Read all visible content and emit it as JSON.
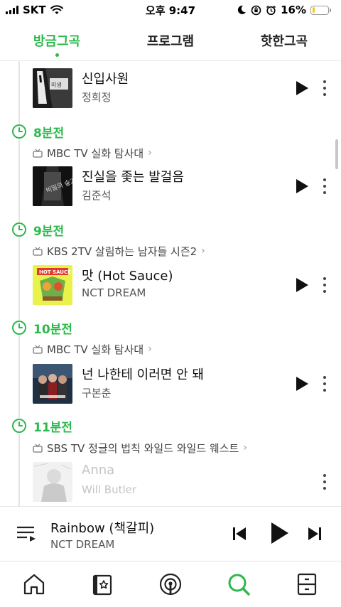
{
  "status_bar": {
    "carrier": "SKT",
    "time": "오후 9:47",
    "battery_percent": "16%",
    "battery_level": 0.16
  },
  "tabs": [
    {
      "label": "방금그곡",
      "active": true
    },
    {
      "label": "프로그램",
      "active": false
    },
    {
      "label": "핫한그곡",
      "active": false
    }
  ],
  "list": {
    "first_song": {
      "title": "신입사원",
      "artist": "정희정"
    },
    "sections": [
      {
        "time": "8분전",
        "program": "MBC TV 실화 탐사대",
        "song": {
          "title": "진실을 좇는 발걸음",
          "artist": "김준석"
        }
      },
      {
        "time": "9분전",
        "program": "KBS 2TV 살림하는 남자들 시즌2",
        "song": {
          "title": "맛 (Hot Sauce)",
          "artist": "NCT DREAM"
        }
      },
      {
        "time": "10분전",
        "program": "MBC TV 실화 탐사대",
        "song": {
          "title": "넌 나한테 이러면 안 돼",
          "artist": "구본춘"
        }
      },
      {
        "time": "11분전",
        "program": "SBS TV 정글의 법칙 와일드 와일드 웨스트",
        "song": {
          "title": "Anna",
          "artist": "Will Butler"
        }
      }
    ]
  },
  "mini_player": {
    "title": "Rainbow (책갈피)",
    "artist": "NCT DREAM"
  },
  "colors": {
    "accent": "#2db84b",
    "battery": "#f5c518"
  },
  "bottom_nav": [
    {
      "icon": "home-icon"
    },
    {
      "icon": "library-icon"
    },
    {
      "icon": "podcast-icon"
    },
    {
      "icon": "search-icon",
      "active": true
    },
    {
      "icon": "menu-icon"
    }
  ]
}
